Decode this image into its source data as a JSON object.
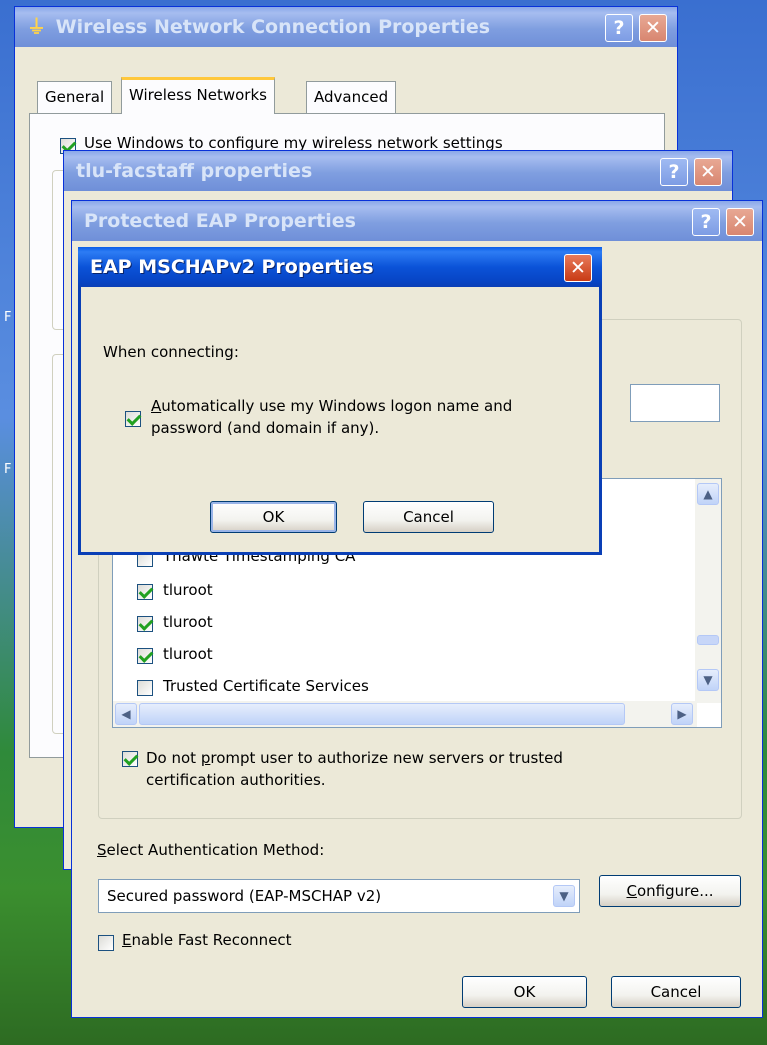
{
  "desktop": {
    "icon_labels": [
      "F",
      "F"
    ]
  },
  "wnc": {
    "title": "Wireless Network Connection Properties",
    "help": "?",
    "close": "✕",
    "tabs": [
      "General",
      "Wireless Networks",
      "Advanced"
    ],
    "use_windows_label": "Use Windows to configure my wireless network settings"
  },
  "tlu": {
    "title": "tlu-facstaff properties",
    "help": "?",
    "close": "✕"
  },
  "peap": {
    "title": "Protected EAP Properties",
    "help": "?",
    "close": "✕",
    "certs": [
      {
        "label": "Thawte Timestamping CA",
        "checked": false
      },
      {
        "label": "tluroot",
        "checked": true
      },
      {
        "label": "tluroot",
        "checked": true
      },
      {
        "label": "tluroot",
        "checked": true
      },
      {
        "label": "Trusted Certificate Services",
        "checked": false
      }
    ],
    "do_not_prompt": {
      "pre": "Do not ",
      "key": "p",
      "post": "rompt user to authorize new servers or trusted",
      "line2": "certification authorities.",
      "checked": true
    },
    "select_method_label": {
      "key": "S",
      "rest": "elect Authentication Method:"
    },
    "method_value": "Secured password (EAP-MSCHAP v2)",
    "configure_button": {
      "key": "C",
      "rest": "onfigure..."
    },
    "fast_reconnect": {
      "key": "E",
      "rest": "nable Fast Reconnect",
      "checked": false
    },
    "ok": "OK",
    "cancel": "Cancel"
  },
  "mschap": {
    "title": "EAP MSCHAPv2 Properties",
    "close": "✕",
    "when_connecting": "When connecting:",
    "auto_logon": {
      "pre": "",
      "key": "A",
      "post": "utomatically use my Windows logon name and",
      "line2": "password (and domain if any).",
      "checked": true
    },
    "ok": "OK",
    "cancel": "Cancel"
  }
}
